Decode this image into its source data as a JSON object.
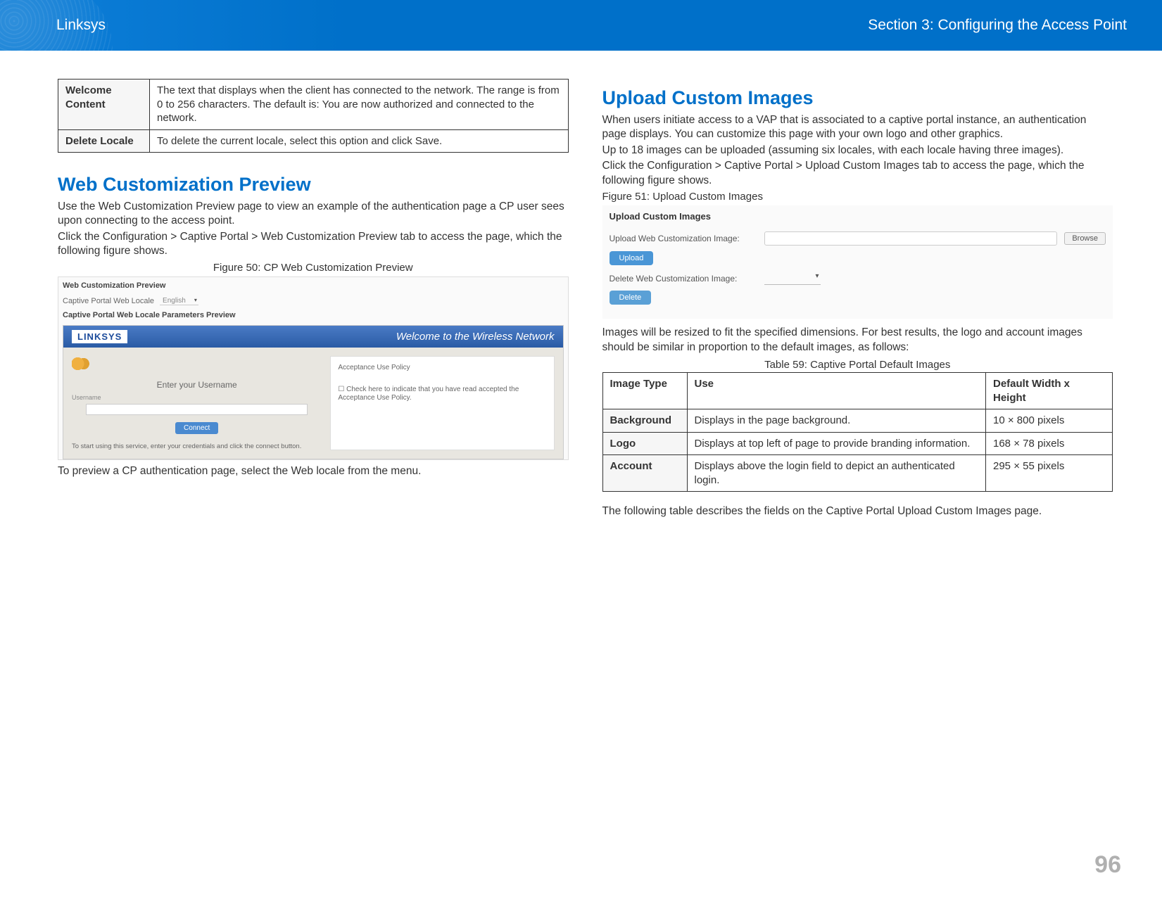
{
  "header": {
    "brand": "Linksys",
    "section": "Section 3:  Configuring the Access Point"
  },
  "left": {
    "defs": {
      "welcome_label": "Welcome Content",
      "welcome_text": "The text that displays when the client has connected to the network. The range is from 0 to 256 characters. The default is: You are now authorized and connected to the network.",
      "delete_label": "Delete Locale",
      "delete_text": "To delete the current locale, select this option and click Save."
    },
    "heading": "Web Customization Preview",
    "p1": "Use the Web Customization Preview page to view an example of the authentication page a CP user sees upon connecting to the access point.",
    "p2": "Click the Configuration > Captive Portal > Web Customization Preview tab to access the page, which the following figure shows.",
    "fig_caption": "Figure 50: CP Web Customization Preview",
    "screenshot": {
      "title": "Web Customization Preview",
      "locale_label": "Captive Portal Web Locale",
      "locale_value": "English",
      "params_label": "Captive Portal Web Locale Parameters Preview",
      "bar_logo": "LINKSYS",
      "bar_text": "Welcome to the Wireless Network",
      "enter": "Enter your Username",
      "uname": "Username",
      "connect": "Connect",
      "foot": "To start using this service, enter your credentials and click the connect button.",
      "policy_title": "Acceptance Use Policy",
      "policy_check": "Check here to indicate that you have read accepted the Acceptance Use Policy."
    },
    "p3": "To preview a CP authentication page, select the Web locale from the menu."
  },
  "right": {
    "heading": "Upload Custom Images",
    "p1": "When users initiate access to a VAP that is associated to a captive portal instance, an authentication page displays. You can customize this page with your own logo and other graphics.",
    "p2": "Up to 18 images can be uploaded (assuming six locales, with each locale having three images).",
    "p3": "Click the Configuration > Captive Portal > Upload Custom Images tab to access the page, which the following figure shows.",
    "fig_caption": "Figure 51: Upload Custom Images",
    "screenshot": {
      "title": "Upload Custom Images",
      "upload_label": "Upload Web Customization Image:",
      "browse": "Browse",
      "upload_btn": "Upload",
      "delete_label": "Delete Web Customization Image:",
      "delete_btn": "Delete"
    },
    "p4": "Images will be resized to fit the specified dimensions. For best results, the logo and account images should be similar in proportion to the default images, as follows:",
    "table_caption": "Table 59: Captive Portal Default Images",
    "table": {
      "h1": "Image Type",
      "h2": "Use",
      "h3": "Default Width x Height",
      "rows": [
        {
          "type": "Background",
          "use": "Displays in the page background.",
          "dim": "10 × 800 pixels"
        },
        {
          "type": "Logo",
          "use": "Displays at top left of page to provide branding information.",
          "dim": "168 × 78 pixels"
        },
        {
          "type": "Account",
          "use": "Displays above the login field to depict an authenticated login.",
          "dim": "295 × 55 pixels"
        }
      ]
    },
    "p5": "The following table describes the fields on the Captive Portal Upload Custom Images page."
  },
  "page_number": "96"
}
